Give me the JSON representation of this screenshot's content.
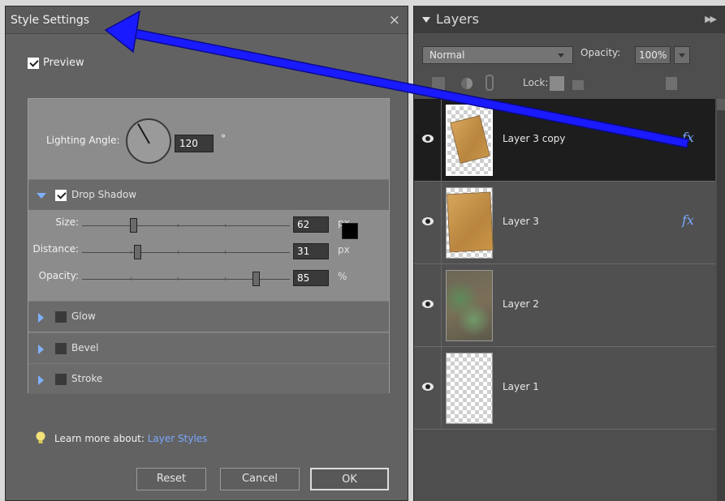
{
  "dialog": {
    "title": "Style Settings",
    "close_glyph": "×",
    "preview_label": "Preview",
    "lighting_angle_label": "Lighting Angle:",
    "lighting_angle_value": "120",
    "degree_symbol": "°",
    "sections": {
      "drop_shadow": "Drop Shadow",
      "glow": "Glow",
      "bevel": "Bevel",
      "stroke": "Stroke"
    },
    "drop_shadow": {
      "size_label": "Size:",
      "size_value": "62",
      "size_unit": "px",
      "distance_label": "Distance:",
      "distance_value": "31",
      "distance_unit": "px",
      "opacity_label": "Opacity:",
      "opacity_value": "85",
      "opacity_unit": "%",
      "shadow_color": "#000000"
    },
    "learn_more_label": "Learn more about:",
    "learn_more_link": "Layer Styles",
    "buttons": {
      "reset": "Reset",
      "cancel": "Cancel",
      "ok": "OK"
    }
  },
  "layers_panel": {
    "title": "Layers",
    "blend_mode": "Normal",
    "opacity_label": "Opacity:",
    "opacity_value": "100%",
    "lock_label": "Lock:",
    "layers": [
      {
        "name": "Layer 3 copy",
        "selected": true,
        "has_fx": true
      },
      {
        "name": "Layer 3",
        "selected": false,
        "has_fx": true
      },
      {
        "name": "Layer 2",
        "selected": false,
        "has_fx": false
      },
      {
        "name": "Layer 1",
        "selected": false,
        "has_fx": false
      }
    ],
    "fx_label": "fx"
  },
  "icons": {
    "close": "close-icon",
    "eye": "eye-icon",
    "fx": "fx-icon",
    "bulb": "lightbulb-icon",
    "trash": "trash-icon",
    "lock": "lock-icon"
  },
  "colors": {
    "annotation_arrow": "#1a1aff",
    "link": "#7aa8ff"
  }
}
